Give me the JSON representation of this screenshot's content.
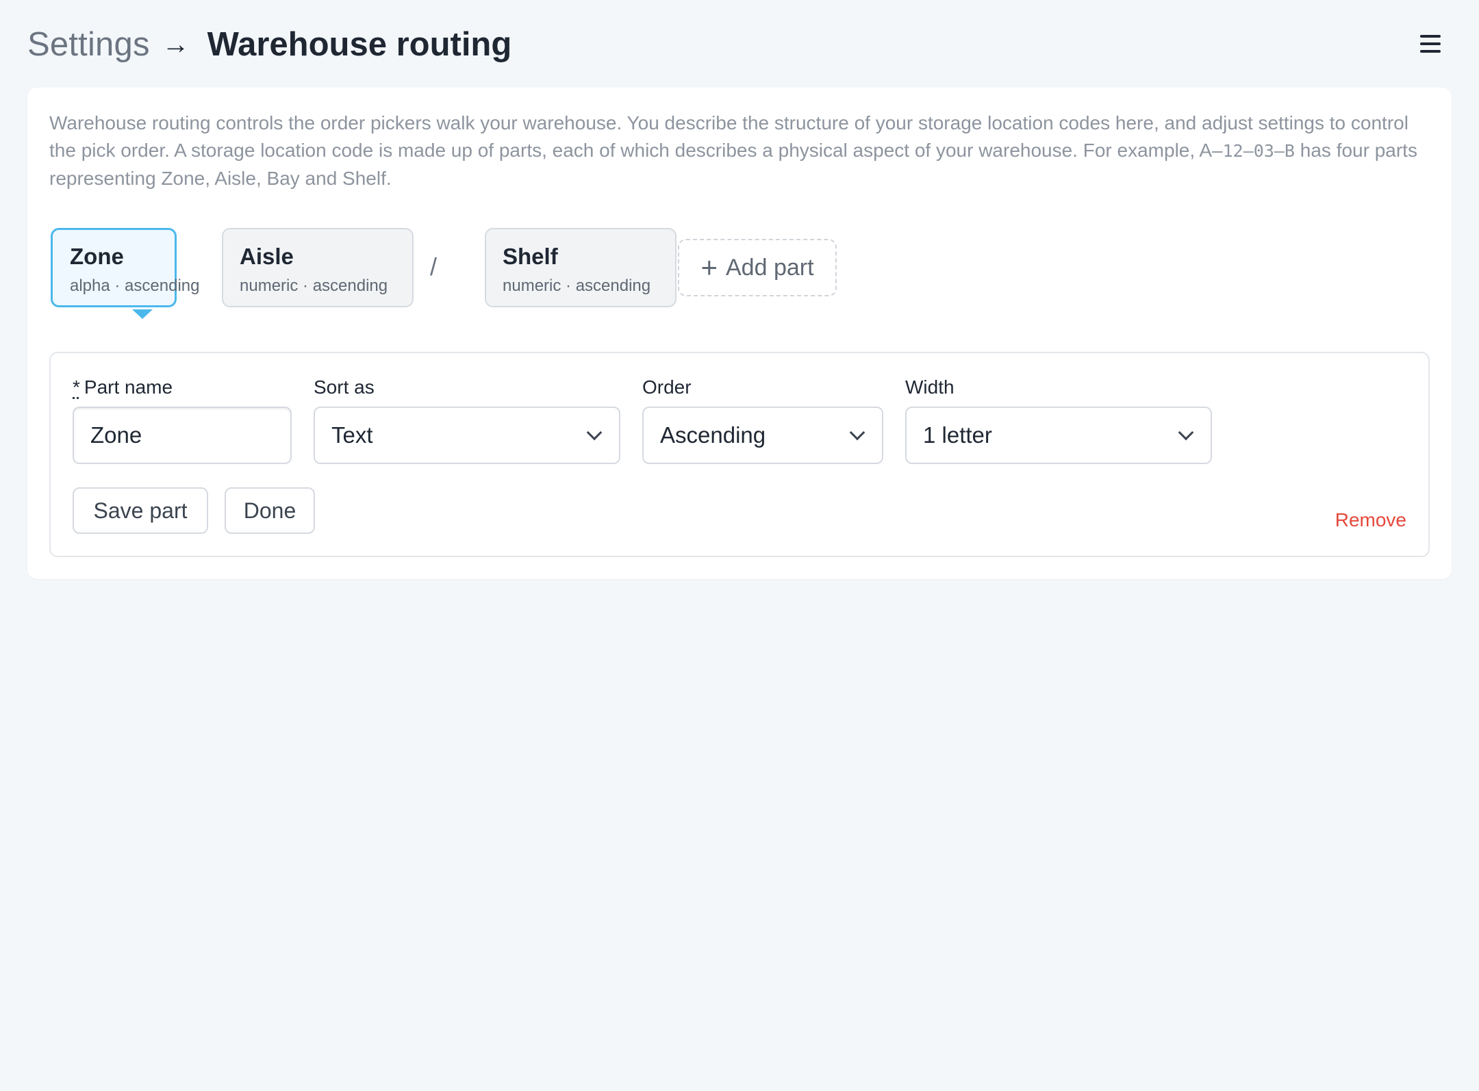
{
  "header": {
    "breadcrumb_parent": "Settings",
    "breadcrumb_arrow": "→",
    "title": "Warehouse routing",
    "menu_icon": "hamburger-menu-icon"
  },
  "intro": {
    "text_part1": "Warehouse routing controls the order pickers walk your warehouse. You describe the structure of your storage location codes here, and adjust settings to control the pick order. A storage location code is made up of parts, each of which describes a physical aspect of your warehouse. For example, A–",
    "example_code": "12–03–B",
    "text_part2": " has four parts representing Zone, Aisle, Bay and Shelf."
  },
  "parts": [
    {
      "name": "Zone",
      "meta": "alpha · ascending",
      "selected": true
    },
    {
      "name": "Aisle",
      "meta": "numeric · ascending",
      "selected": false
    },
    {
      "name": "Shelf",
      "meta": "numeric · ascending",
      "selected": false
    }
  ],
  "separator": "/",
  "add_part": {
    "icon": "plus-icon",
    "label": "Add part"
  },
  "editor": {
    "part_name": {
      "required_mark": "*",
      "label": "Part name",
      "value": "Zone"
    },
    "sort_as": {
      "label": "Sort as",
      "value": "Text"
    },
    "order": {
      "label": "Order",
      "value": "Ascending"
    },
    "width": {
      "label": "Width",
      "value": "1 letter"
    },
    "save_label": "Save part",
    "done_label": "Done",
    "remove_label": "Remove"
  },
  "colors": {
    "accent": "#4bb8ec",
    "danger": "#e5483b",
    "background": "#f4f7fa"
  }
}
